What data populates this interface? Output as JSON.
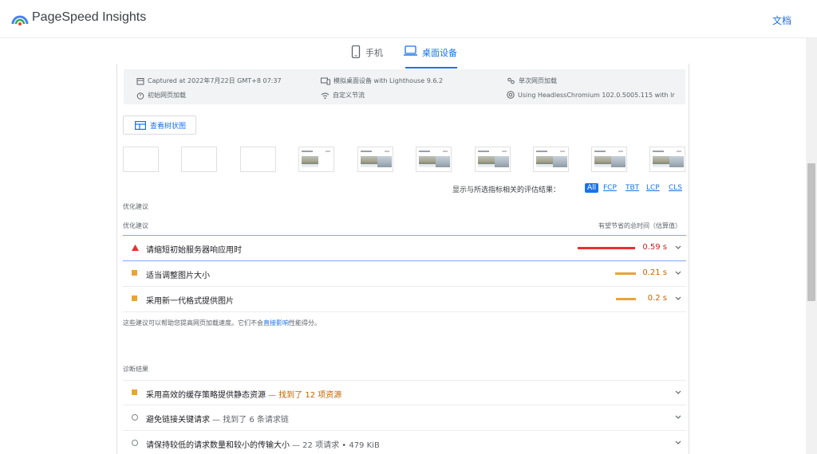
{
  "header": {
    "app_title": "PageSpeed Insights",
    "docs_label": "文档",
    "logo_icon": "pagespeed-logo-icon"
  },
  "tabs": [
    {
      "label": "手机",
      "icon": "smartphone-icon",
      "selected": false
    },
    {
      "label": "桌面设备",
      "icon": "laptop-icon",
      "selected": true
    }
  ],
  "environment": {
    "captured": "Captured at 2022年7月22日 GMT+8 07:37",
    "initial_load": "初始网页加载",
    "emulated": "模拟桌面设备 with Lighthouse 9.6.2",
    "throttling": "自定义节流",
    "single_load": "单次网页加载",
    "browser": "Using HeadlessChromium 102.0.5005.115 with lr"
  },
  "tree_button_label": "查看树状图",
  "thumbnails": {
    "count": 10,
    "loaded_from_index": 3
  },
  "filter": {
    "label": "显示与所选指标相关的评估结果：",
    "options": [
      "All",
      "FCP",
      "TBT",
      "LCP",
      "CLS"
    ],
    "selected": "All"
  },
  "opportunities": {
    "section_title": "优化建议",
    "column_title": "优化建议",
    "column_savings": "有望节省的总时间（估算值）",
    "items": [
      {
        "title": "请缩短初始服务器响应用时",
        "savings": "0.59 s",
        "severity": "fail"
      },
      {
        "title": "适当调整图片大小",
        "savings": "0.21 s",
        "severity": "average"
      },
      {
        "title": "采用新一代格式提供图片",
        "savings": "0.2 s",
        "severity": "average"
      }
    ],
    "description_before": "这些建议可以帮助您提高网页加载速度。它们不会",
    "description_link": "直接影响",
    "description_after": "性能得分。"
  },
  "diagnostics": {
    "section_title": "诊断结果",
    "items": [
      {
        "title": "采用高效的缓存策略提供静态资源",
        "display": "— 找到了 12 项资源",
        "severity": "average"
      },
      {
        "title": "避免链接关键请求",
        "display": "— 找到了 6 条请求链",
        "severity": "info"
      },
      {
        "title": "请保持较低的请求数量和较小的传输大小",
        "display": "— 22 项请求 • 479 KiB",
        "severity": "info"
      }
    ]
  },
  "colors": {
    "accent": "#1a73e8",
    "fail": "#eb2f2f",
    "fail_text": "#c5221f",
    "average": "#e8a33a",
    "average_text": "#c26401"
  }
}
